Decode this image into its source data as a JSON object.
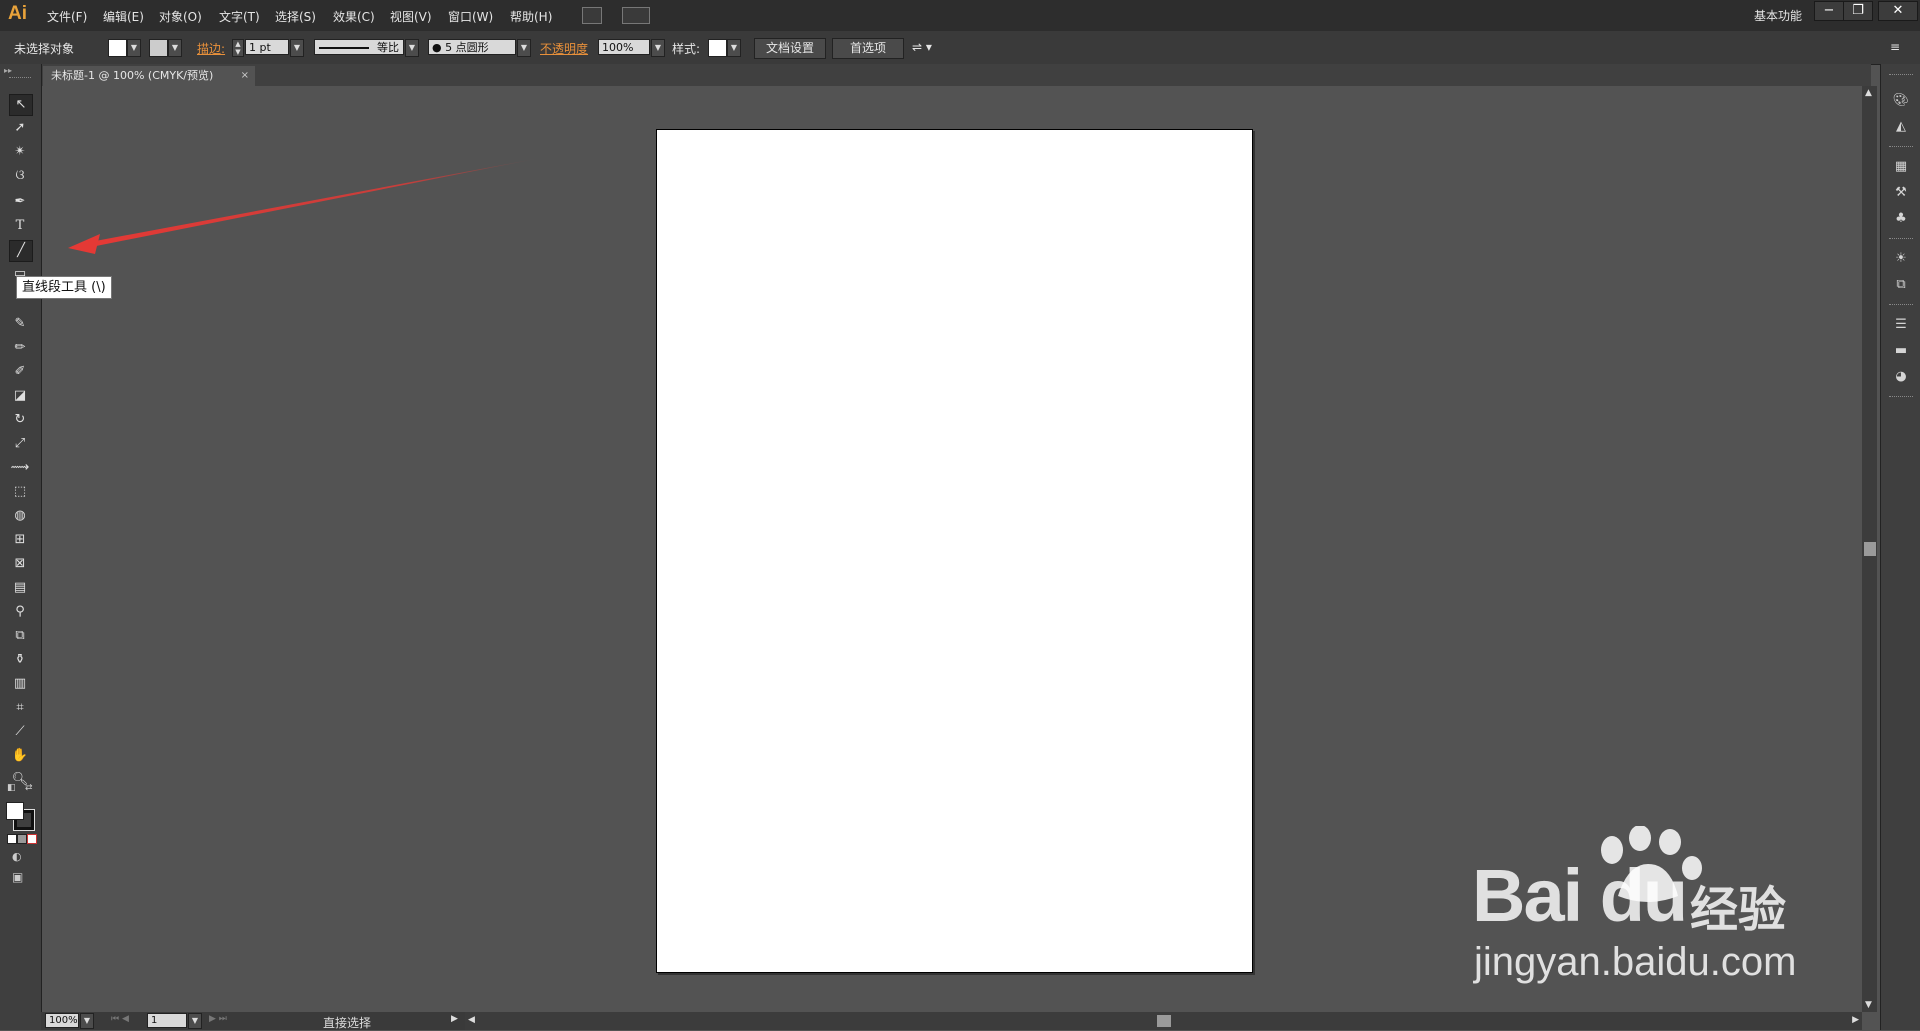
{
  "app": {
    "logo": "Ai"
  },
  "menubar": {
    "items": [
      "文件(F)",
      "编辑(E)",
      "对象(O)",
      "文字(T)",
      "选择(S)",
      "效果(C)",
      "视图(V)",
      "窗口(W)",
      "帮助(H)"
    ],
    "workspace_label": "基本功能",
    "window_buttons": [
      "−",
      "❐",
      "✕"
    ]
  },
  "controlbar": {
    "selection_label": "未选择对象",
    "stroke_label": "描边:",
    "stroke_value": "1 pt",
    "stroke_profile": "等比",
    "brush_value": "5 点圆形",
    "opacity_label": "不透明度",
    "opacity_value": "100%",
    "style_label": "样式:",
    "doc_setup_button": "文档设置",
    "preferences_button": "首选项"
  },
  "document": {
    "tab_title": "未标题-1 @ 100% (CMYK/预览)",
    "tab_close": "×"
  },
  "tooltip": {
    "text": "直线段工具 (\\)"
  },
  "tools": [
    "selection-tool-icon",
    "direct-selection-tool-icon",
    "magic-wand-tool-icon",
    "lasso-tool-icon",
    "pen-tool-icon",
    "type-tool-icon",
    "line-segment-tool-icon",
    "rectangle-tool-icon",
    "paintbrush-tool-icon",
    "pencil-tool-icon",
    "blob-brush-tool-icon",
    "eraser-tool-icon",
    "rotate-tool-icon",
    "scale-tool-icon",
    "width-tool-icon",
    "free-transform-tool-icon",
    "shape-builder-tool-icon",
    "perspective-grid-tool-icon",
    "mesh-tool-icon",
    "gradient-tool-icon",
    "eyedropper-tool-icon",
    "blend-tool-icon",
    "symbol-sprayer-tool-icon",
    "column-graph-tool-icon",
    "artboard-tool-icon",
    "slice-tool-icon",
    "hand-tool-icon",
    "zoom-tool-icon"
  ],
  "statusbar": {
    "zoom_value": "100%",
    "page_value": "1",
    "status_text": "直接选择"
  },
  "watermark": {
    "brand": "Bai du",
    "brand_cn": "经验",
    "url": "jingyan.baidu.com"
  },
  "colors": {
    "accent_orange": "#e8903a",
    "logo_orange": "#e8a23a",
    "arrow_red": "#e53935",
    "canvas_gray": "#535353"
  }
}
